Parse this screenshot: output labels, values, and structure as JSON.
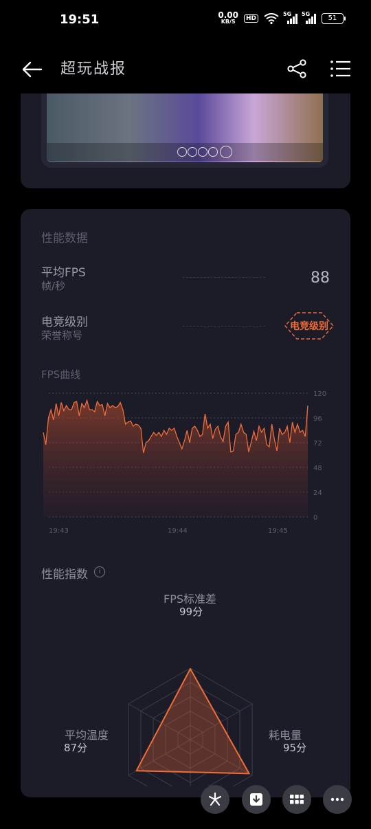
{
  "status_bar": {
    "time": "19:51",
    "net_speed_value": "0.00",
    "net_speed_unit": "KB/S",
    "hd_badge": "HD",
    "network_1": "5G",
    "network_2": "5G",
    "battery": "51"
  },
  "app_bar": {
    "title": "超玩战报",
    "back_icon": "arrow-left-icon",
    "share_icon": "share-icon",
    "menu_icon": "list-menu-icon"
  },
  "performance": {
    "section_title": "性能数据",
    "avg_fps_label": "平均FPS",
    "avg_fps_unit": "帧/秒",
    "avg_fps_value": "88",
    "esports_label": "电竞级别",
    "esports_sub": "荣誉称号",
    "esports_badge": "电竞级别",
    "accent_color": "#f06d39"
  },
  "chart_data": {
    "type": "area",
    "title": "FPS曲线",
    "y_ticks": [
      "120",
      "96",
      "72",
      "48",
      "24",
      "0"
    ],
    "ylim": [
      0,
      120
    ],
    "x_ticks": [
      "19:43",
      "19:44",
      "19:45"
    ],
    "values": [
      82,
      70,
      96,
      104,
      94,
      110,
      98,
      111,
      103,
      108,
      104,
      104,
      111,
      112,
      98,
      110,
      106,
      113,
      104,
      104,
      102,
      112,
      108,
      109,
      98,
      110,
      106,
      108,
      106,
      107,
      111,
      104,
      90,
      92,
      93,
      88,
      90,
      89,
      86,
      62,
      72,
      74,
      78,
      82,
      79,
      82,
      78,
      84,
      80,
      86,
      84,
      86,
      78,
      72,
      66,
      74,
      84,
      72,
      86,
      88,
      84,
      78,
      80,
      100,
      86,
      90,
      76,
      85,
      88,
      78,
      73,
      88,
      92,
      63,
      64,
      80,
      82,
      90,
      82,
      80,
      63,
      73,
      83,
      74,
      88,
      82,
      86,
      70,
      68,
      90,
      75,
      64,
      86,
      80,
      82,
      88,
      72,
      92,
      82,
      90,
      82,
      84,
      78,
      108
    ]
  },
  "radar": {
    "title": "性能指数",
    "info_icon": "info-icon",
    "axes": [
      {
        "label": "FPS标准差",
        "score": "99分",
        "value": 99
      },
      {
        "label": "耗电量",
        "score": "95分",
        "value": 95
      },
      {
        "label": "平均温度",
        "score": "87分",
        "value": 87
      }
    ]
  },
  "floating_buttons": [
    "pinwheel-icon",
    "download-icon",
    "grid-icon",
    "more-dots-icon"
  ]
}
